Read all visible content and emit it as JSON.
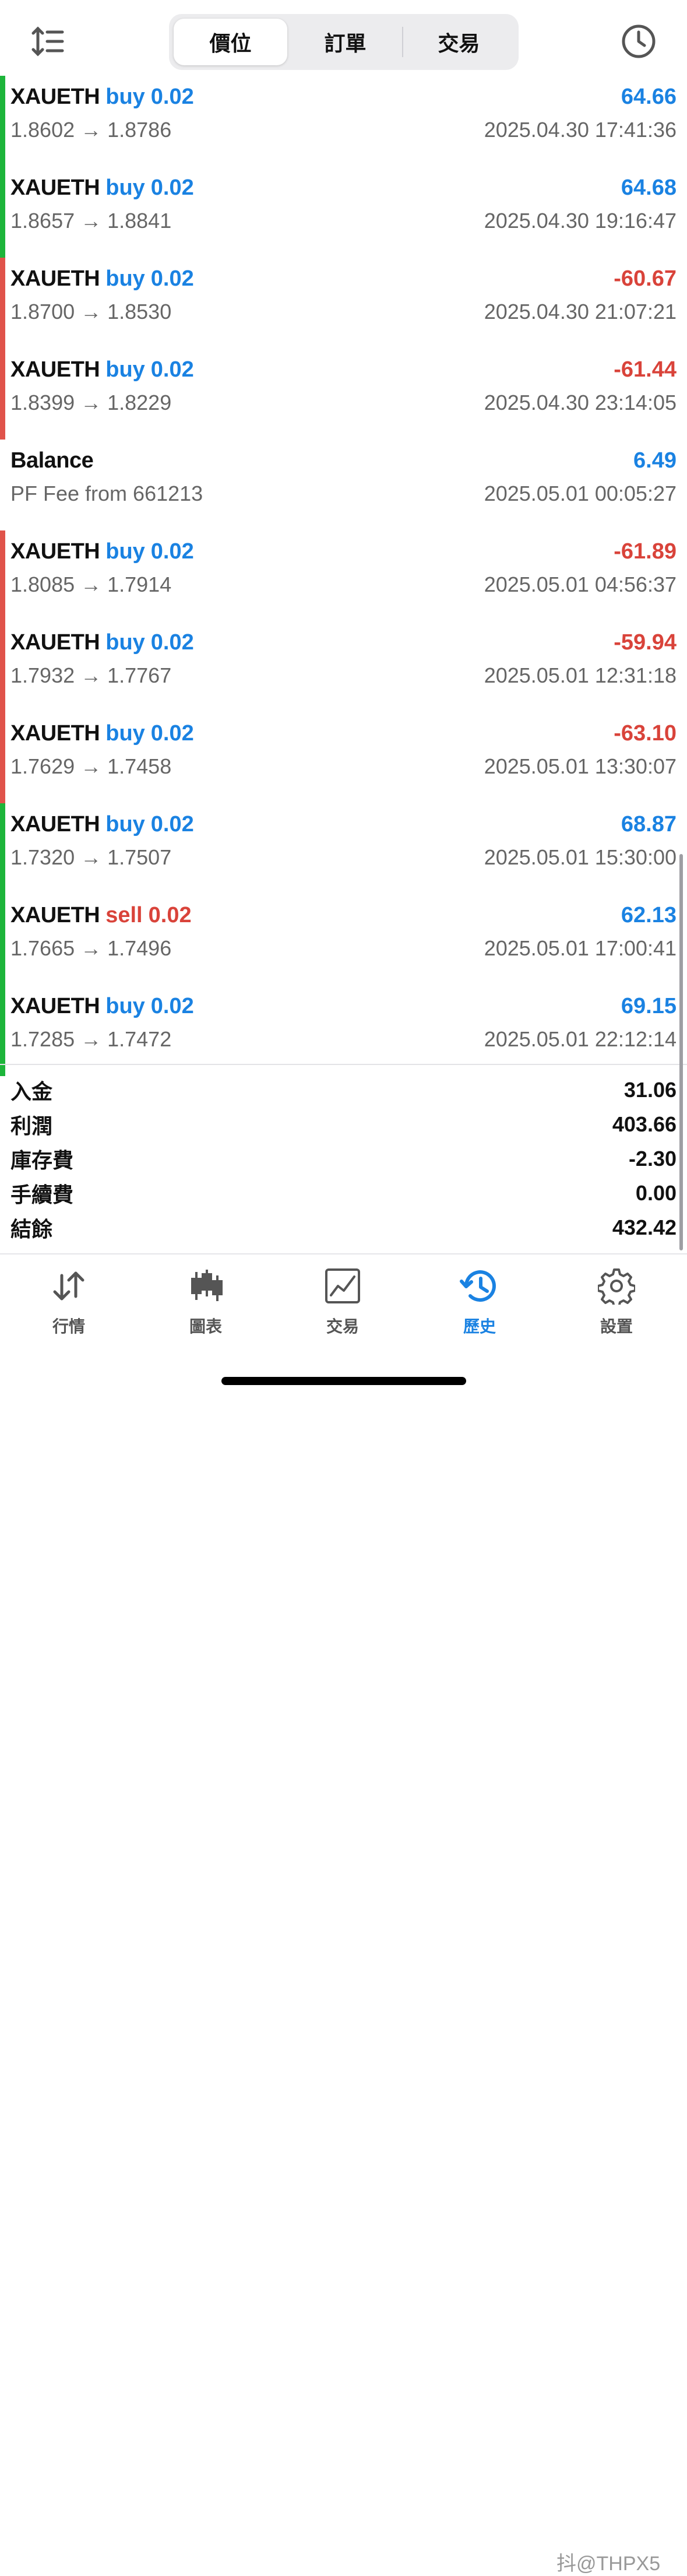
{
  "header": {
    "tabs": [
      {
        "label": "價位",
        "active": true
      },
      {
        "label": "訂單",
        "active": false
      },
      {
        "label": "交易",
        "active": false
      }
    ],
    "left_icon": "sort-icon",
    "right_icon": "clock-icon"
  },
  "colors": {
    "profit": "#1a82e2",
    "loss": "#d9433a",
    "win_bar": "#1db53a",
    "loss_bar": "#e0534a"
  },
  "rows": [
    {
      "symbol": "XAUETH",
      "side": "buy",
      "volume": "0.02",
      "prices": "1.8602 → 1.8786",
      "profit": "64.66",
      "time": "2025.04.30 17:41:36",
      "result": "win"
    },
    {
      "symbol": "XAUETH",
      "side": "buy",
      "volume": "0.02",
      "prices": "1.8657 → 1.8841",
      "profit": "64.68",
      "time": "2025.04.30 19:16:47",
      "result": "win"
    },
    {
      "symbol": "XAUETH",
      "side": "buy",
      "volume": "0.02",
      "prices": "1.8700 → 1.8530",
      "profit": "-60.67",
      "time": "2025.04.30 21:07:21",
      "result": "loss"
    },
    {
      "symbol": "XAUETH",
      "side": "buy",
      "volume": "0.02",
      "prices": "1.8399 → 1.8229",
      "profit": "-61.44",
      "time": "2025.04.30 23:14:05",
      "result": "loss"
    },
    {
      "symbol": "Balance",
      "side": "",
      "volume": "",
      "prices": "PF Fee from 661213",
      "profit": "6.49",
      "time": "2025.05.01 00:05:27",
      "result": "none"
    },
    {
      "symbol": "XAUETH",
      "side": "buy",
      "volume": "0.02",
      "prices": "1.8085 → 1.7914",
      "profit": "-61.89",
      "time": "2025.05.01 04:56:37",
      "result": "loss"
    },
    {
      "symbol": "XAUETH",
      "side": "buy",
      "volume": "0.02",
      "prices": "1.7932 → 1.7767",
      "profit": "-59.94",
      "time": "2025.05.01 12:31:18",
      "result": "loss"
    },
    {
      "symbol": "XAUETH",
      "side": "buy",
      "volume": "0.02",
      "prices": "1.7629 → 1.7458",
      "profit": "-63.10",
      "time": "2025.05.01 13:30:07",
      "result": "loss"
    },
    {
      "symbol": "XAUETH",
      "side": "buy",
      "volume": "0.02",
      "prices": "1.7320 → 1.7507",
      "profit": "68.87",
      "time": "2025.05.01 15:30:00",
      "result": "win"
    },
    {
      "symbol": "XAUETH",
      "side": "sell",
      "volume": "0.02",
      "prices": "1.7665 → 1.7496",
      "profit": "62.13",
      "time": "2025.05.01 17:00:41",
      "result": "win"
    },
    {
      "symbol": "XAUETH",
      "side": "buy",
      "volume": "0.02",
      "prices": "1.7285 → 1.7472",
      "profit": "69.15",
      "time": "2025.05.01 22:12:14",
      "result": "win"
    }
  ],
  "summary": [
    {
      "label": "入金",
      "value": "31.06"
    },
    {
      "label": "利潤",
      "value": "403.66"
    },
    {
      "label": "庫存費",
      "value": "-2.30"
    },
    {
      "label": "手續費",
      "value": "0.00"
    },
    {
      "label": "結餘",
      "value": "432.42"
    }
  ],
  "tabbar": [
    {
      "label": "行情",
      "icon": "quotes-arrows-icon",
      "active": false
    },
    {
      "label": "圖表",
      "icon": "candlestick-chart-icon",
      "active": false
    },
    {
      "label": "交易",
      "icon": "trade-chart-icon",
      "active": false
    },
    {
      "label": "歷史",
      "icon": "history-clock-icon",
      "active": true
    },
    {
      "label": "設置",
      "icon": "gear-icon",
      "active": false
    }
  ],
  "watermark": "抖@THPX5"
}
